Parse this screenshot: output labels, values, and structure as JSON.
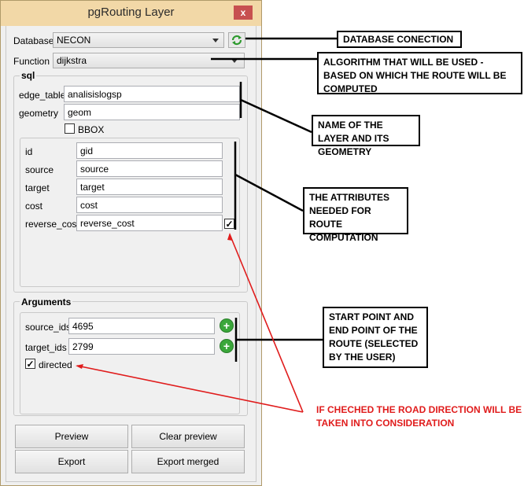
{
  "window": {
    "title": "pgRouting Layer",
    "close_label": "x"
  },
  "database": {
    "label": "Database",
    "value": "NECON"
  },
  "function": {
    "label": "Function",
    "value": "dijkstra"
  },
  "sql": {
    "title": "sql",
    "edge_table_label": "edge_table",
    "edge_table_value": "analisislogsp",
    "geometry_label": "geometry",
    "geometry_value": "geom",
    "bbox_label": "BBOX",
    "id_label": "id",
    "id_value": "gid",
    "source_label": "source",
    "source_value": "source",
    "target_label": "target",
    "target_value": "target",
    "cost_label": "cost",
    "cost_value": "cost",
    "reverse_cost_label": "reverse_cost",
    "reverse_cost_value": "reverse_cost",
    "reverse_cost_check": "✓"
  },
  "arguments": {
    "title": "Arguments",
    "source_ids_label": "source_ids",
    "source_ids_value": "4695",
    "target_ids_label": "target_ids",
    "target_ids_value": "2799",
    "directed_label": "directed",
    "directed_check": "✓",
    "plus": "+"
  },
  "buttons": {
    "preview": "Preview",
    "clear_preview": "Clear preview",
    "export": "Export",
    "export_merged": "Export merged"
  },
  "annotations": {
    "db": "DATABASE CONECTION",
    "algo": "ALGORITHM THAT WILL BE USED - BASED ON WHICH THE ROUTE WILL BE COMPUTED",
    "layer": "NAME OF THE LAYER AND ITS GEOMETRY",
    "attrs": "THE ATTRIBUTES NEEDED FOR ROUTE COMPUTATION",
    "points": "START POINT AND END POINT OF THE ROUTE (SELECTED BY THE USER)",
    "directed_note": "IF CHECHED THE ROAD DIRECTION WILL BE TAKEN INTO CONSIDERATION"
  },
  "colors": {
    "title_bar": "#f2d8a7",
    "close": "#c75050",
    "red_note": "#e01c1c",
    "plus": "#3aa73a"
  },
  "icons": {
    "refresh": "refresh-icon",
    "plus": "plus-icon",
    "close": "close-icon"
  }
}
